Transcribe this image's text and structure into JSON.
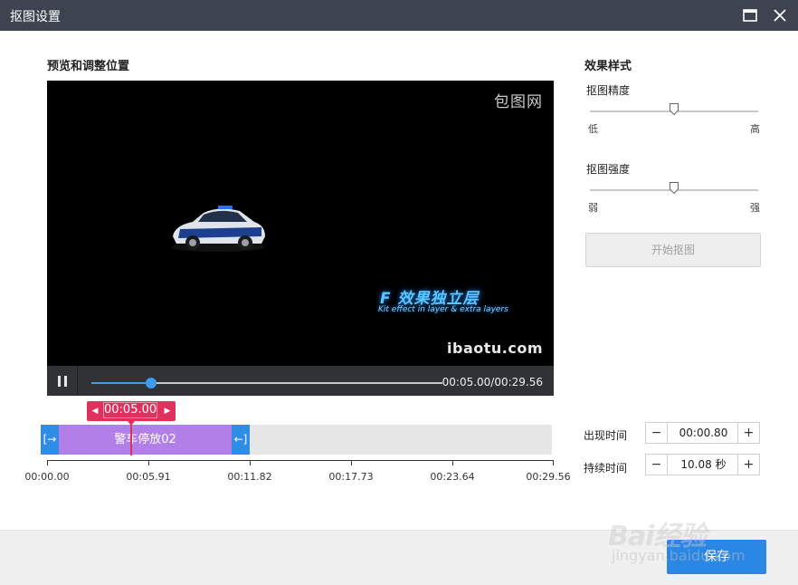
{
  "window": {
    "title": "抠图设置"
  },
  "preview": {
    "section_title": "预览和调整位置",
    "watermark_top": "包图网",
    "watermark_bottom": "ibaotu.com",
    "effect_logo": "F 效果独立层",
    "effect_subtitle": "Kit effect in layer & extra layers",
    "timecode": "00:05.00/00:29.56",
    "progress": 0.17
  },
  "timeline": {
    "playhead_time": "00:05.00",
    "clip_label": "警车停放02",
    "ruler_labels": [
      "00:00.00",
      "00:05.91",
      "00:11.82",
      "00:17.73",
      "00:23.64",
      "00:29.56"
    ]
  },
  "effect": {
    "section_title": "效果样式",
    "precision": {
      "label": "抠图精度",
      "min_label": "低",
      "max_label": "高",
      "value": 0.5
    },
    "strength": {
      "label": "抠图强度",
      "min_label": "弱",
      "max_label": "强",
      "value": 0.5
    },
    "start_button": "开始抠图"
  },
  "timing": {
    "appear_label": "出现时间",
    "appear_value": "00:00.80",
    "duration_label": "持续时间",
    "duration_value": "10.08 秒"
  },
  "footer": {
    "save_button": "保存",
    "watermark_main": "Bai经验",
    "watermark_url": "jingyan.baidu.com"
  },
  "colors": {
    "titlebar": "#3d4450",
    "accent": "#2a87e6",
    "playhead": "#e0305e",
    "clip": "#b27fe8"
  }
}
